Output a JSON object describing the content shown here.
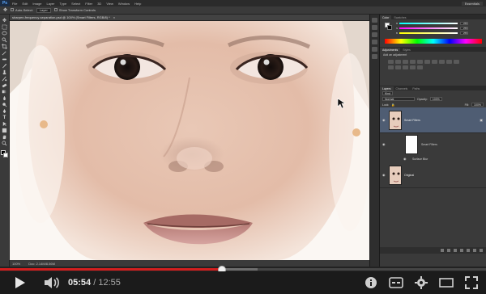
{
  "photoshop": {
    "logo": "Ps",
    "menu": [
      "File",
      "Edit",
      "Image",
      "Layer",
      "Type",
      "Select",
      "Filter",
      "3D",
      "View",
      "Window",
      "Help"
    ],
    "workspace": "Essentials",
    "options": {
      "auto_select_label": "Auto-Select:",
      "auto_select_value": "Layer",
      "show_transform_label": "Show Transform Controls"
    },
    "document_tab": "sharpen-frequency-separation.psd @ 100% (Smart Filters, RGB/8) *",
    "status": {
      "zoom": "100%",
      "doc_size": "Doc: 2.14M/8.56M"
    },
    "color_panel": {
      "tabs": [
        "Color",
        "Swatches"
      ],
      "sliders": [
        {
          "label": "R",
          "value": "255"
        },
        {
          "label": "G",
          "value": "255"
        },
        {
          "label": "B",
          "value": "255"
        }
      ]
    },
    "adjustments_panel": {
      "tabs": [
        "Adjustments",
        "Styles"
      ],
      "title": "Add an adjustment"
    },
    "layers_panel": {
      "tabs": [
        "Layers",
        "Channels",
        "Paths"
      ],
      "kind_label": "Kind",
      "blend_mode": "Normal",
      "opacity_label": "Opacity:",
      "opacity_value": "100%",
      "lock_label": "Lock:",
      "fill_label": "Fill:",
      "fill_value": "100%",
      "layers": [
        {
          "name": "Smart Filters"
        },
        {
          "name": "Original"
        }
      ],
      "smart_filters_label": "Smart Filters",
      "surface_blur_label": "Surface Blur"
    }
  },
  "player": {
    "current_time": "05:54",
    "duration": "12:55",
    "played_fraction": 0.457,
    "loaded_fraction": 0.53
  },
  "colors": {
    "progress_played": "#d31f1f",
    "ps_selected_layer": "#4f5d73"
  }
}
